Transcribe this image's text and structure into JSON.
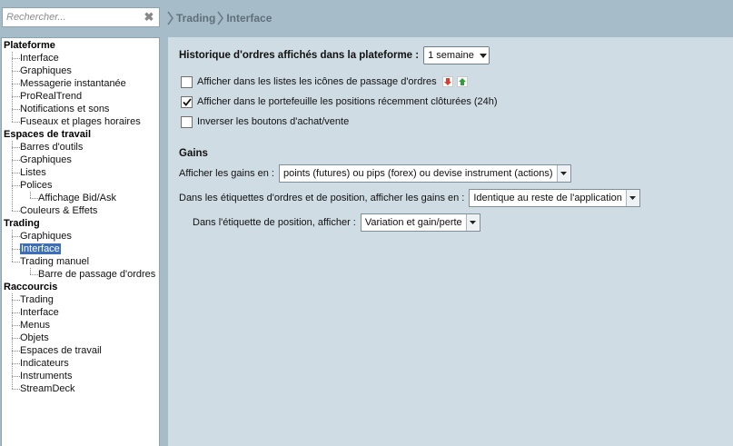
{
  "search": {
    "placeholder": "Rechercher..."
  },
  "breadcrumb": [
    "Trading",
    "Interface"
  ],
  "sidebar": {
    "sections": [
      {
        "label": "Plateforme",
        "items": [
          "Interface",
          "Graphiques",
          "Messagerie instantanée",
          "ProRealTrend",
          "Notifications et sons",
          "Fuseaux et plages horaires"
        ]
      },
      {
        "label": "Espaces de travail",
        "items": [
          "Barres d'outils",
          "Graphiques",
          "Listes",
          "Polices",
          "Affichage Bid/Ask",
          "Couleurs & Effets"
        ]
      },
      {
        "label": "Trading",
        "items": [
          "Graphiques",
          "Interface",
          "Trading manuel",
          "Barre de passage d'ordres"
        ]
      },
      {
        "label": "Raccourcis",
        "items": [
          "Trading",
          "Interface",
          "Menus",
          "Objets",
          "Espaces de travail",
          "Indicateurs",
          "Instruments",
          "StreamDeck"
        ]
      }
    ],
    "selected": "Trading > Interface"
  },
  "main": {
    "history": {
      "label": "Historique d'ordres affichés dans la plateforme :",
      "value": "1 semaine"
    },
    "checkboxes": [
      {
        "label": "Afficher dans les listes les icônes de passage d'ordres",
        "checked": false
      },
      {
        "label": "Afficher dans le portefeuille les positions récemment clôturées (24h)",
        "checked": true
      },
      {
        "label": "Inverser les boutons d'achat/vente",
        "checked": false
      }
    ],
    "gains": {
      "title": "Gains",
      "display": {
        "label": "Afficher les gains en :",
        "value": "points (futures) ou pips (forex) ou devise instrument (actions)"
      },
      "labels": {
        "label": "Dans les étiquettes d'ordres et de position, afficher les gains en :",
        "value": "Identique au reste de l'application"
      },
      "position": {
        "label": "Dans l'étiquette de position, afficher :",
        "value": "Variation et gain/perte"
      }
    }
  },
  "colors": {
    "accent": "#3d6fb8",
    "panel": "#cfdce4",
    "topbar": "#a7bcc9",
    "sell_icon": "#e03a2f",
    "buy_icon": "#2e9d3a"
  }
}
